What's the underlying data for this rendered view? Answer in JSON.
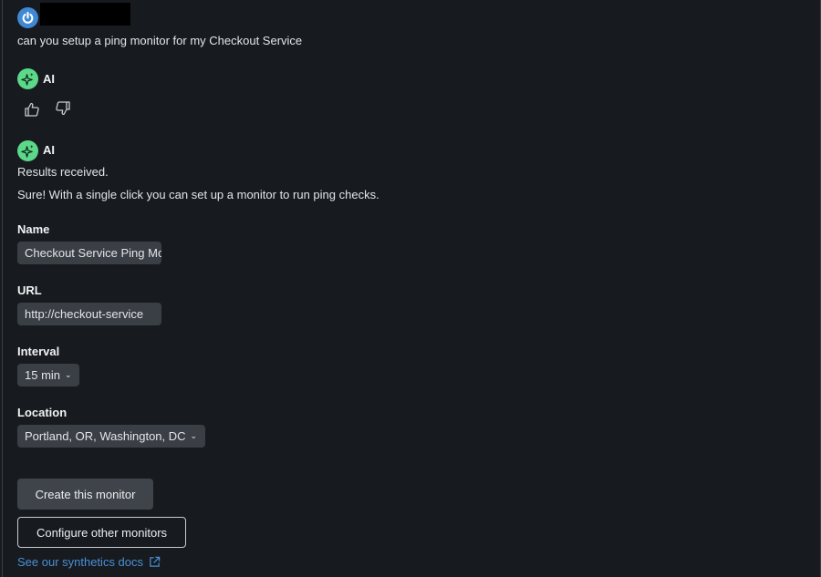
{
  "user_message": {
    "avatar_icon": "power-icon",
    "text": "can you setup a ping monitor for my Checkout Service"
  },
  "ai_turn_1": {
    "name": "AI",
    "avatar_icon": "sparkles-icon",
    "feedback": [
      "thumbs-up-icon",
      "thumbs-down-icon"
    ]
  },
  "ai_turn_2": {
    "name": "AI",
    "status": "Results received.",
    "message": "Sure! With a single click you can set up a monitor to run ping checks.",
    "form": {
      "name_label": "Name",
      "name_value": "Checkout Service Ping Monitor",
      "url_label": "URL",
      "url_value": "http://checkout-service",
      "interval_label": "Interval",
      "interval_value": "15 min",
      "location_label": "Location",
      "location_value": "Portland, OR, Washington, DC"
    },
    "create_button": "Create this monitor",
    "configure_button": "Configure other monitors",
    "docs_link": "See our synthetics docs"
  },
  "colors": {
    "background": "#171b1f",
    "ai_avatar": "#5bd88a",
    "user_avatar": "#3f88d4",
    "link": "#4a8fd6"
  }
}
